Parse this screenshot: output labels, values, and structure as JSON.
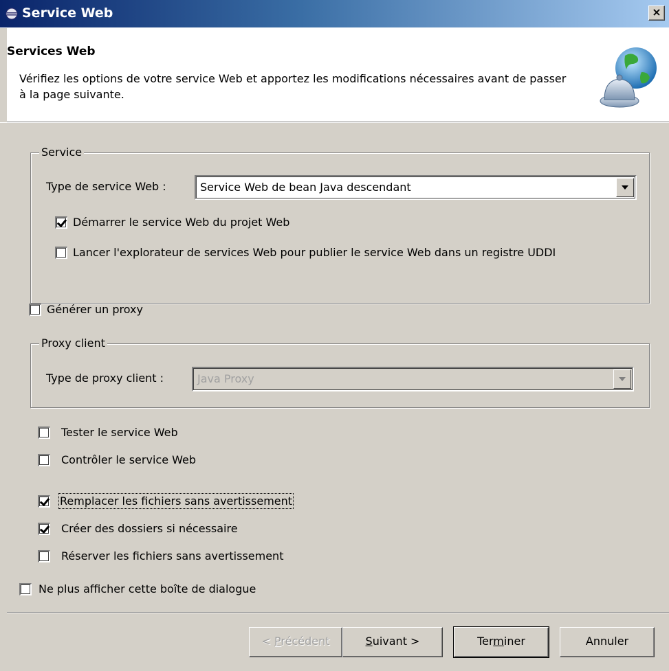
{
  "window": {
    "title": "Service Web",
    "close_label": "×"
  },
  "banner": {
    "title": "Services Web",
    "description": "Vérifiez les options de votre service Web et apportez les modifications nécessaires avant de passer à la page suivante.",
    "icon": "globe-bell-icon"
  },
  "service_group": {
    "legend": "Service",
    "type_label": "Type de service Web :",
    "type_value": "Service Web de bean Java descendant",
    "start_checkbox": {
      "label": "Démarrer le service Web du projet Web",
      "checked": true
    },
    "launch_checkbox": {
      "label": "Lancer l'explorateur de services Web pour publier le service Web dans un registre UDDI",
      "checked": false
    }
  },
  "generate_proxy": {
    "label": "Générer un proxy",
    "checked": false
  },
  "proxy_group": {
    "legend": "Proxy client",
    "type_label": "Type de proxy client :",
    "type_value": "Java Proxy"
  },
  "options": {
    "test": {
      "label": "Tester le service Web",
      "checked": false
    },
    "monitor": {
      "label": "Contrôler le service Web",
      "checked": false
    },
    "overwrite": {
      "label": "Remplacer les fichiers sans avertissement",
      "checked": true
    },
    "create_folders": {
      "label": "Créer des dossiers si nécessaire",
      "checked": true
    },
    "checkout": {
      "label": "Réserver les fichiers sans avertissement",
      "checked": false
    }
  },
  "dont_show": {
    "label": "Ne plus afficher cette boîte de dialogue",
    "checked": false
  },
  "buttons": {
    "back_pre": "< ",
    "back_mnemonic": "P",
    "back_post": "récédent",
    "next_mnemonic": "S",
    "next_post": "uivant >",
    "finish_pre": "Ter",
    "finish_mnemonic": "m",
    "finish_post": "iner",
    "cancel": "Annuler"
  }
}
